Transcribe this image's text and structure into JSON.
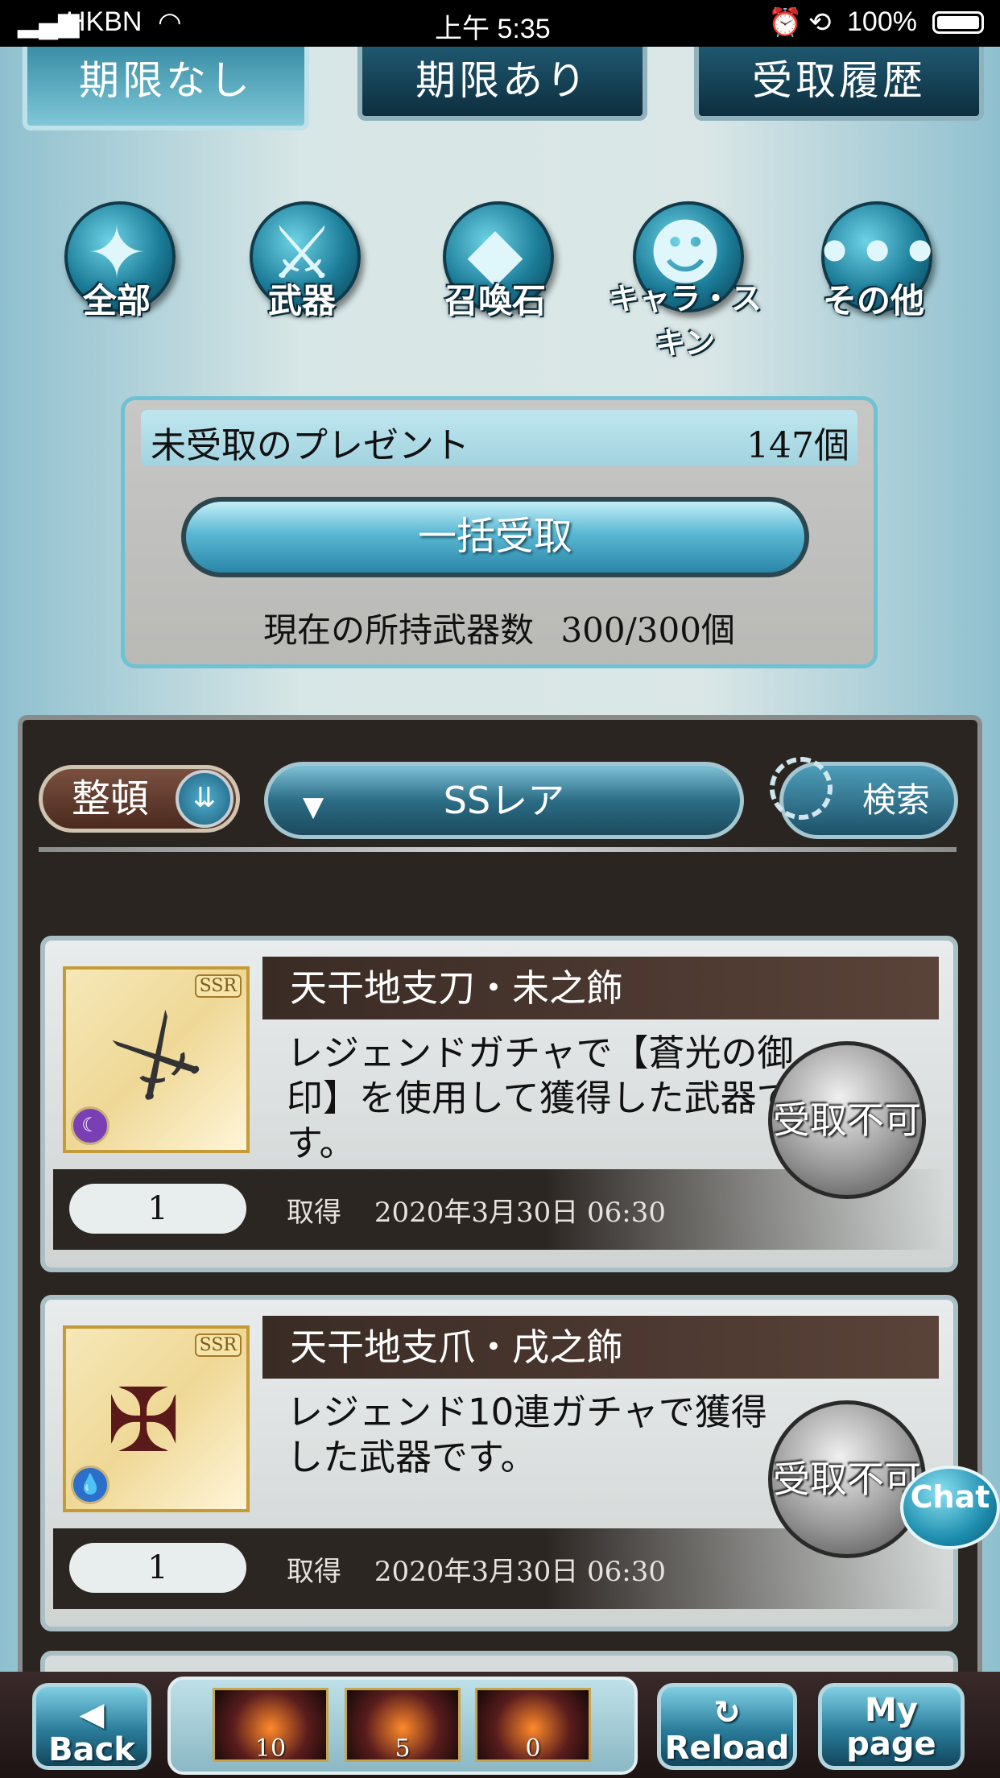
{
  "status_bar": {
    "carrier": "HKBN",
    "time": "上午 5:35",
    "battery": "100%"
  },
  "tabs": [
    {
      "label": "期限なし",
      "active": true
    },
    {
      "label": "期限あり",
      "active": false
    },
    {
      "label": "受取履歴",
      "active": false
    }
  ],
  "categories": [
    {
      "label": "全部",
      "icon": "all-icon"
    },
    {
      "label": "武器",
      "icon": "sword-icon"
    },
    {
      "label": "召喚石",
      "icon": "crystal-icon"
    },
    {
      "label": "キャラ・スキン",
      "icon": "character-icon"
    },
    {
      "label": "その他",
      "icon": "ellipsis-icon"
    }
  ],
  "summary": {
    "title": "未受取のプレゼント",
    "count": "147個",
    "bulk_button": "一括受取",
    "weapon_count_label": "現在の所持武器数",
    "weapon_count_value": "300/300個"
  },
  "filters": {
    "sort_label": "整頓",
    "rarity_select": "SSレア",
    "search_label": "検索"
  },
  "items": [
    {
      "name": "天干地支刀・未之飾",
      "rarity": "SSR",
      "description": "レジェンドガチャで【蒼光の御印】を使用して獲得した武器です。",
      "quantity": "1",
      "acquired_label": "取得",
      "acquired_date": "2020年3月30日 06:30",
      "receive_button": "受取不可",
      "element_color": "#7b3fb5"
    },
    {
      "name": "天干地支爪・戌之飾",
      "rarity": "SSR",
      "description": "レジェンド10連ガチャで獲得した武器です。",
      "quantity": "1",
      "acquired_label": "取得",
      "acquired_date": "2020年3月30日 06:30",
      "receive_button": "受取不可",
      "element_color": "#2a6fc9"
    }
  ],
  "chat_button": "Chat",
  "bottom_nav": {
    "back_label": "Back",
    "reload_label": "Reload",
    "mypage_label": "My page",
    "slots": [
      {
        "count": "10"
      },
      {
        "count": "5"
      },
      {
        "count": "0"
      }
    ]
  }
}
